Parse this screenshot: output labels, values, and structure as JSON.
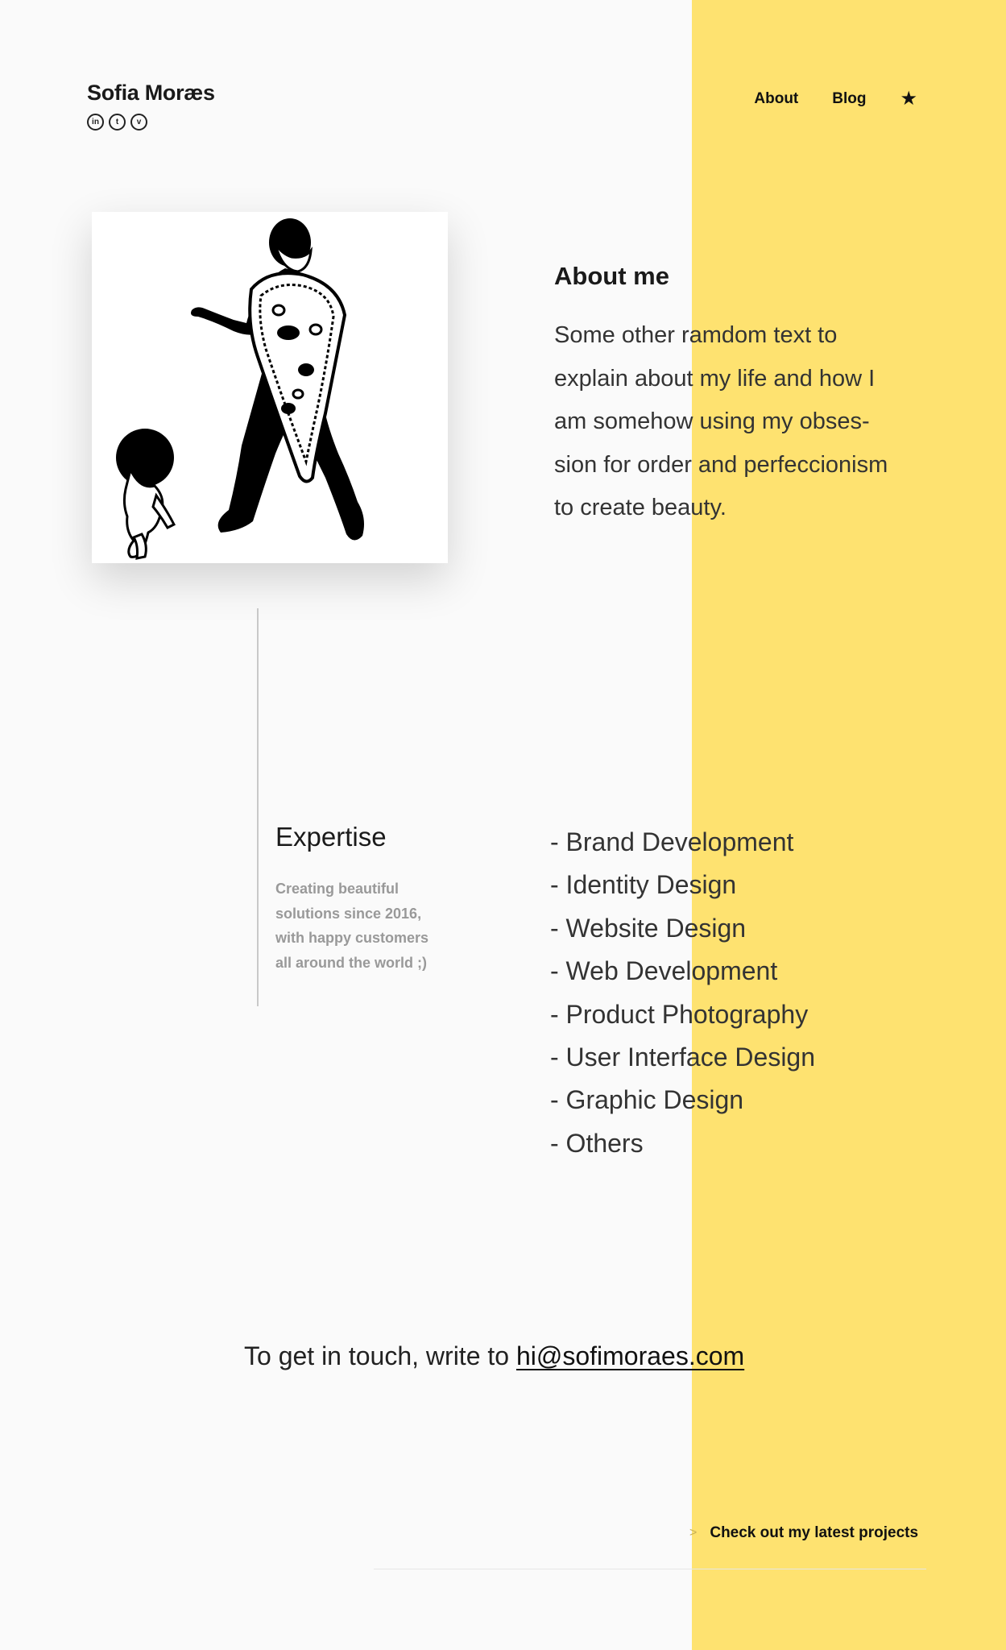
{
  "header": {
    "brand": "Sofia Moræs",
    "socials": [
      {
        "icon": "linkedin-icon",
        "glyph": "in"
      },
      {
        "icon": "tumblr-icon",
        "glyph": "t"
      },
      {
        "icon": "vimeo-icon",
        "glyph": "v"
      }
    ],
    "nav": {
      "about": "About",
      "blog": "Blog",
      "star_icon": "star-icon"
    }
  },
  "about": {
    "title": "About me",
    "lines": [
      "Some other ramdom text to",
      "explain about my life and how I",
      "am somehow using my obses-",
      "sion for order and perfeccionism",
      "to create beauty."
    ]
  },
  "expertise": {
    "title": "Expertise",
    "subtitle_lines": [
      "Creating beautiful",
      "solutions since 2016,",
      "with happy customers",
      "all around the world ;)"
    ],
    "items": [
      "- Brand Development",
      "- Identity Design",
      "- Website Design",
      "- Web Development",
      "- Product Photography",
      "- User Interface Design",
      "- Graphic Design",
      "- Others"
    ]
  },
  "contact": {
    "prefix": "To get in touch, write to ",
    "email": "hi@sofimoraes.com"
  },
  "footer": {
    "chevron": ">",
    "projects_label": "Check out my latest projects"
  },
  "colors": {
    "accent_band": "#fee270",
    "background": "#fafafa"
  }
}
